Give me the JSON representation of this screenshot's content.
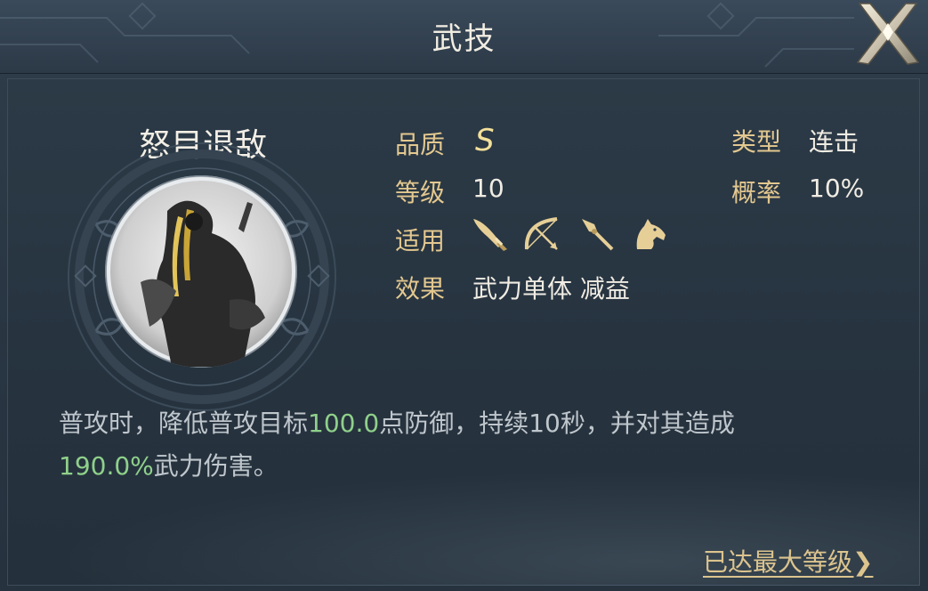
{
  "window": {
    "title": "武技",
    "close_icon": "close-x-icon"
  },
  "skill": {
    "name": "怒目退敌",
    "quality_label": "品质",
    "quality_value": "S",
    "level_label": "等级",
    "level_value": "10",
    "applicable_label": "适用",
    "applicable_icons": [
      "sword-icon",
      "bow-icon",
      "spear-icon",
      "horse-icon"
    ],
    "effect_label": "效果",
    "effect_value": "武力单体 减益",
    "type_label": "类型",
    "type_value": "连击",
    "chance_label": "概率",
    "chance_value": "10%"
  },
  "description": {
    "part1": "普攻时，降低普攻目标",
    "num1": "100.0",
    "part2": "点防御，持续10秒，并对其造成",
    "num2": "190.0%",
    "part3": "武力伤害。"
  },
  "footer": {
    "max_level_label": "已达最大等级",
    "arrow": "❯"
  },
  "colors": {
    "label_gold": "#e3c88f",
    "highlight_green": "#8fd08a",
    "quality_yellow": "#f3e09a"
  }
}
